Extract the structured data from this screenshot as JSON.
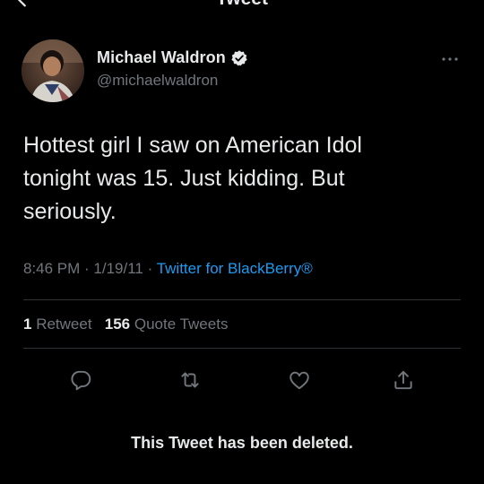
{
  "header": {
    "title": "Tweet"
  },
  "author": {
    "name": "Michael Waldron",
    "handle": "@michaelwaldron",
    "verified": true
  },
  "tweet": {
    "text_lines": [
      "Hottest girl I saw on American Idol",
      "tonight was 15. Just kidding. But",
      "seriously."
    ],
    "time": "8:46 PM",
    "separator": " · ",
    "date": "1/19/11",
    "source": "Twitter for BlackBerry®"
  },
  "stats": {
    "retweets_count": "1",
    "retweets_label": "Retweet",
    "quote_count": "156",
    "quote_label": "Quote Tweets"
  },
  "actions": {
    "icons": [
      "reply-icon",
      "retweet-icon",
      "like-icon",
      "share-icon"
    ]
  },
  "notice": {
    "text": "This Tweet has been deleted."
  },
  "colors": {
    "background": "#000000",
    "text_primary": "#e7e9ea",
    "text_secondary": "#71767b",
    "accent": "#1d9bf0",
    "divider": "#2f3336"
  }
}
